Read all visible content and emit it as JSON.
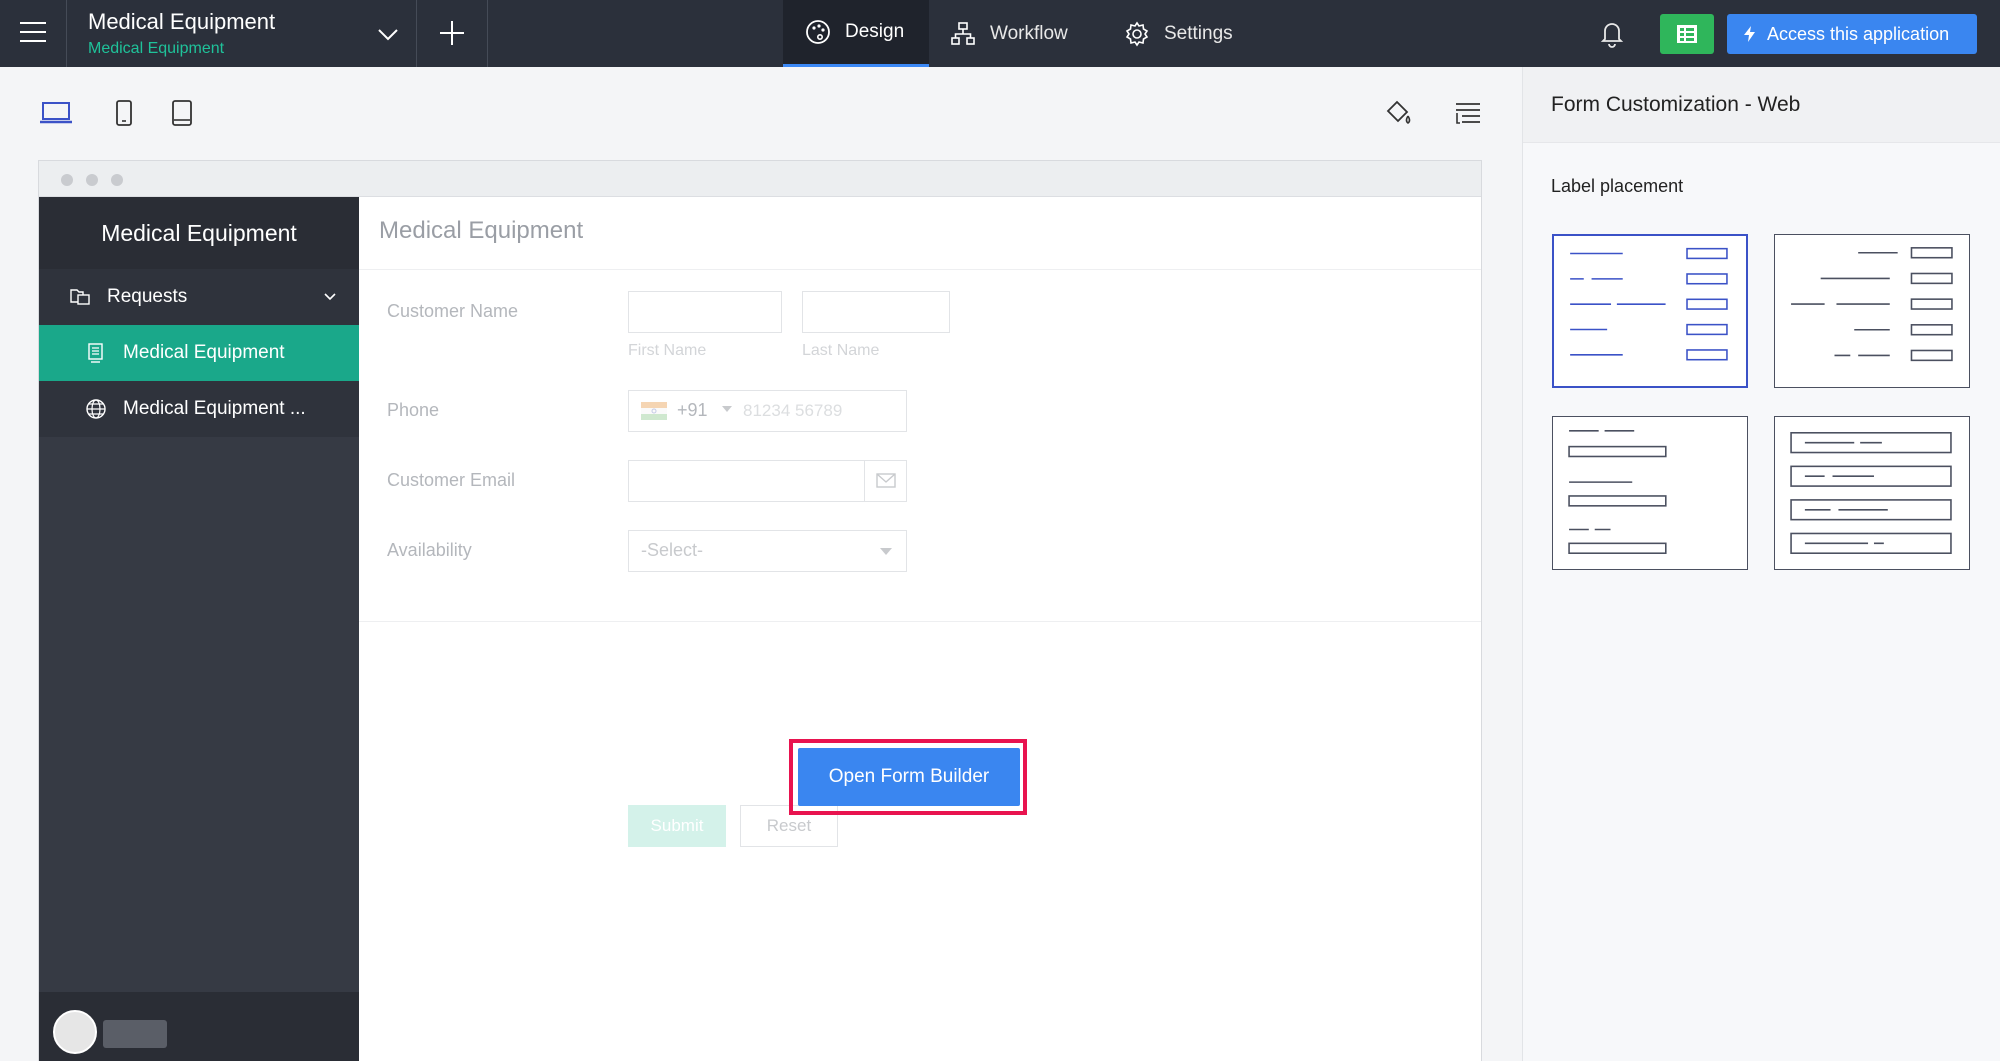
{
  "topbar": {
    "app_title": "Medical Equipment",
    "app_subtitle": "Medical Equipment",
    "tabs": [
      {
        "label": "Design",
        "active": true
      },
      {
        "label": "Workflow",
        "active": false
      },
      {
        "label": "Settings",
        "active": false
      }
    ],
    "access_label": "Access this application"
  },
  "preview": {
    "sidebar": {
      "title": "Medical Equipment",
      "group_label": "Requests",
      "items": [
        {
          "label": "Medical Equipment",
          "active": true
        },
        {
          "label": "Medical Equipment ...",
          "active": false
        }
      ]
    },
    "form": {
      "heading": "Medical Equipment",
      "fields": {
        "customer_name": "Customer Name",
        "first_name_hint": "First Name",
        "last_name_hint": "Last Name",
        "phone": "Phone",
        "phone_code": "+91",
        "phone_placeholder": "81234 56789",
        "customer_email": "Customer Email",
        "availability": "Availability",
        "select_placeholder": "-Select-"
      },
      "submit_label": "Submit",
      "reset_label": "Reset"
    },
    "open_form_builder_label": "Open Form Builder"
  },
  "right_panel": {
    "title": "Form Customization - Web",
    "label_placement_title": "Label placement",
    "selected_option": 1
  },
  "colors": {
    "topbar_bg": "#2b303b",
    "accent_green": "#1aa88a",
    "accent_blue": "#3a86f0",
    "highlight_red": "#e8134f"
  }
}
